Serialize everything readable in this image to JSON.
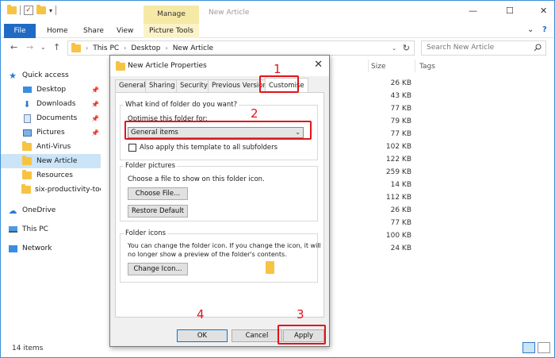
{
  "titlebar": {
    "manage_tab": "Manage",
    "window_title": "New Article",
    "minimize": "—",
    "maximize": "☐",
    "close": "✕"
  },
  "ribbon": {
    "tabs": [
      "File",
      "Home",
      "Share",
      "View",
      "Picture Tools"
    ],
    "collapse_icon": "⌄",
    "help_icon": "?"
  },
  "address": {
    "back": "←",
    "forward": "→",
    "recent": "⌄",
    "up": "↑",
    "crumbs": [
      "This PC",
      "Desktop",
      "New Article"
    ],
    "search_placeholder": "Search New Article"
  },
  "nav": {
    "items": [
      {
        "label": "Quick access"
      },
      {
        "label": "Desktop"
      },
      {
        "label": "Downloads"
      },
      {
        "label": "Documents"
      },
      {
        "label": "Pictures"
      },
      {
        "label": "Anti-Virus"
      },
      {
        "label": "New Article"
      },
      {
        "label": "Resources"
      },
      {
        "label": "six-productivity-toc"
      },
      {
        "label": "OneDrive"
      },
      {
        "label": "This PC"
      },
      {
        "label": "Network"
      }
    ]
  },
  "filelist": {
    "columns": [
      "Size",
      "Tags"
    ],
    "sizes": [
      "26 KB",
      "43 KB",
      "77 KB",
      "79 KB",
      "77 KB",
      "102 KB",
      "122 KB",
      "259 KB",
      "14 KB",
      "112 KB",
      "26 KB",
      "77 KB",
      "100 KB",
      "24 KB"
    ]
  },
  "status": {
    "item_count": "14 items"
  },
  "dialog": {
    "title": "New Article Properties",
    "close": "✕",
    "tabs": [
      "General",
      "Sharing",
      "Security",
      "Previous Versions",
      "Customise"
    ],
    "question": "What kind of folder do you want?",
    "optimise_label": "Optimise this folder for:",
    "optimise_value": "General items",
    "apply_subfolders": "Also apply this template to all subfolders",
    "folder_pictures_label": "Folder pictures",
    "folder_pictures_text": "Choose a file to show on this folder icon.",
    "choose_file": "Choose File...",
    "restore_default": "Restore Default",
    "folder_icons_label": "Folder icons",
    "folder_icons_text1": "You can change the folder icon. If you change the icon, it will",
    "folder_icons_text2": "no longer show a preview of the folder's contents.",
    "change_icon": "Change Icon...",
    "ok": "OK",
    "cancel": "Cancel",
    "apply": "Apply"
  },
  "annotations": {
    "n1": "1",
    "n2": "2",
    "n3": "3",
    "n4": "4",
    "color": "#e1141b"
  }
}
